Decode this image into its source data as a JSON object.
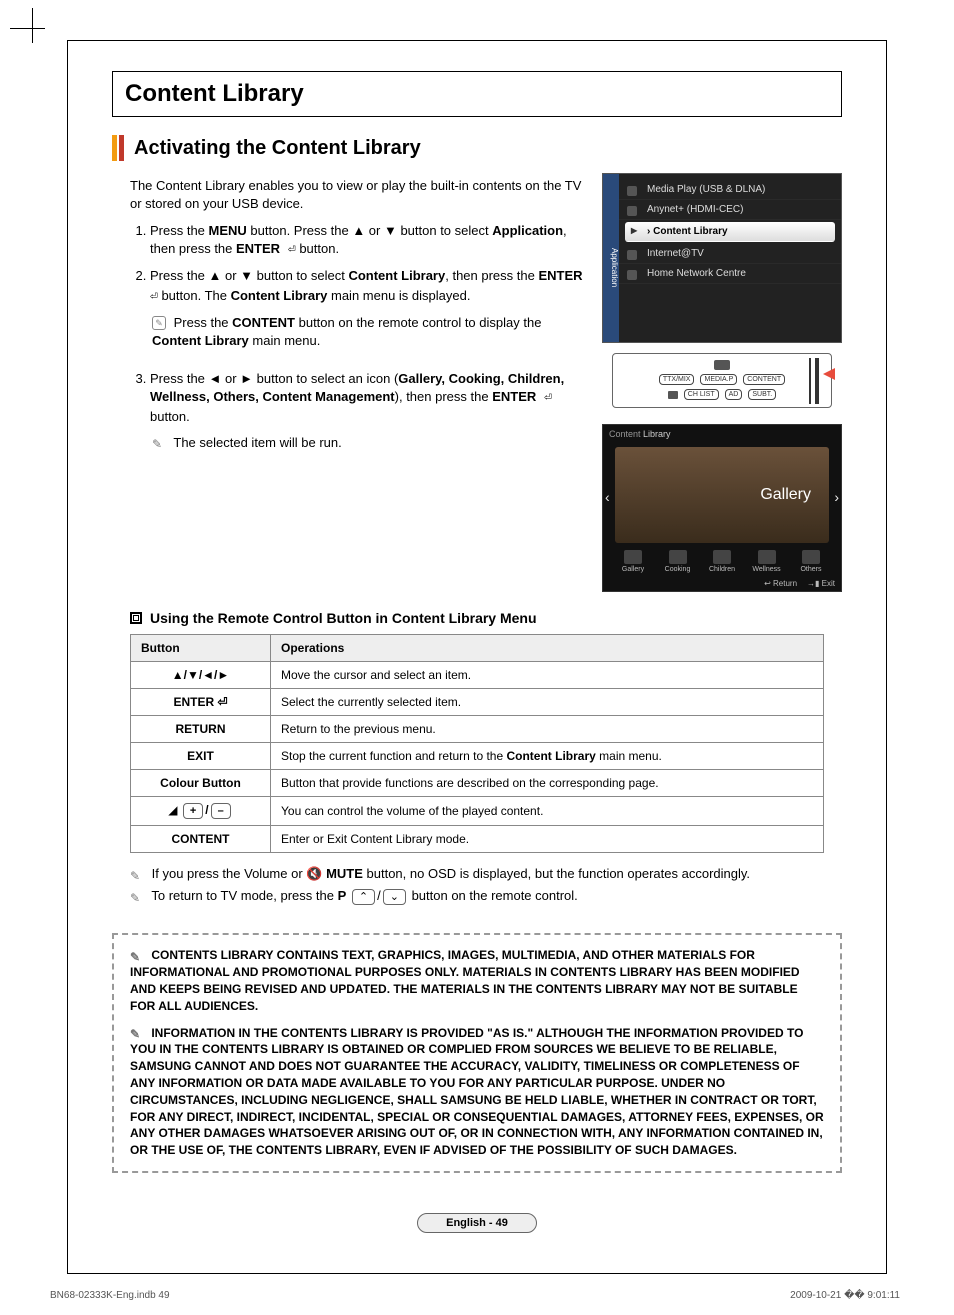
{
  "page_title": "Content Library",
  "section_title": "Activating the Content Library",
  "intro": "The Content Library enables you to view or play the built-in contents on the TV or stored on your USB device.",
  "steps": {
    "s1_a": "Press the ",
    "s1_menu": "MENU",
    "s1_b": " button. Press the ▲ or ▼ button to select ",
    "s1_app": "Application",
    "s1_c": ", then press the ",
    "s1_enter": "ENTER",
    "s1_d": " button.",
    "s2_a": "Press the ▲ or ▼ button to select ",
    "s2_cl": "Content Library",
    "s2_b": ", then press the ",
    "s2_enter": "ENTER",
    "s2_c": " button. The ",
    "s2_cl2": "Content Library",
    "s2_d": " main menu is displayed.",
    "note1_a": "Press the ",
    "note1_content": "CONTENT",
    "note1_b": " button on the remote control to display the ",
    "note1_cl": "Content Library",
    "note1_c": " main menu.",
    "s3_a": "Press the ◄ or ► button to select an icon (",
    "s3_list": "Gallery, Cooking, Children, Wellness, Others, Content Management",
    "s3_b": "), then press the ",
    "s3_enter": "ENTER",
    "s3_c": " button.",
    "note2": "The selected item will be run."
  },
  "osd": {
    "side": "Application",
    "items": [
      "Media Play (USB & DLNA)",
      "Anynet+ (HDMI-CEC)",
      "Content Library",
      "Internet@TV",
      "Home Network Centre"
    ],
    "selected_index": 2
  },
  "remote": {
    "r1": [
      "TTX/MIX",
      "MEDIA.P",
      "CONTENT"
    ],
    "r2": [
      "CH LIST",
      "AD",
      "SUBT."
    ]
  },
  "cl_preview": {
    "head": "Content Library",
    "gallery": "Gallery",
    "icons": [
      "Gallery",
      "Cooking",
      "Children",
      "Wellness",
      "Others"
    ],
    "foot_return": "↩ Return",
    "foot_exit": "→▮ Exit"
  },
  "subsection_title": "Using the Remote Control Button in Content Library Menu",
  "table": {
    "h1": "Button",
    "h2": "Operations",
    "rows": [
      {
        "b": "▲/▼/◄/►",
        "op": "Move the cursor and select an item."
      },
      {
        "b": "ENTER ⏎",
        "op": "Select the currently selected item."
      },
      {
        "b": "RETURN",
        "op": "Return to the previous menu."
      },
      {
        "b": "EXIT",
        "op_a": "Stop the current function and return to the ",
        "op_bold": "Content Library",
        "op_b": " main menu."
      },
      {
        "b": "Colour Button",
        "op": "Button that provide functions are described on the corresponding page."
      },
      {
        "b": "vol",
        "op": "You can control the volume of the played content."
      },
      {
        "b": "CONTENT",
        "op": "Enter or Exit Content Library mode."
      }
    ]
  },
  "below_notes": {
    "n1_a": "If you press the Volume or ",
    "n1_mute": "🔇 MUTE",
    "n1_b": " button, no OSD is displayed, but the function operates accordingly.",
    "n2_a": "To return to TV mode, press the ",
    "n2_p": "P",
    "n2_b": " button on the remote control."
  },
  "legal": {
    "p1": "Contents Library contains text, graphics, images, multimedia, and other materials for informational and promotional purposes only. Materials in Contents Library has been modified and keeps being revised and updated.  The materials in the Contents Library may not be suitable for all audiences.",
    "p2": "Information in the Contents Library is provided \"as is.\" Although the information provided to you in the Contents Library is obtained or complied from sources we believe to be reliable, Samsung cannot and does not guarantee the accuracy, validity, timeliness or completeness of any information or data made available to you for any particular purpose. Under no circumstances, including negligence, shall Samsung be held liable, whether in contract or tort, for any direct, indirect, incidental, special or consequential damages, attorney fees, expenses, or any other damages whatsoever arising out of, or in connection with, any information contained in, or the use of, the Contents Library, even if advised of the possibility of such damages."
  },
  "page_number": "English - 49",
  "footer_left": "BN68-02333K-Eng.indb   49",
  "footer_right": "2009-10-21   �� 9:01:11"
}
